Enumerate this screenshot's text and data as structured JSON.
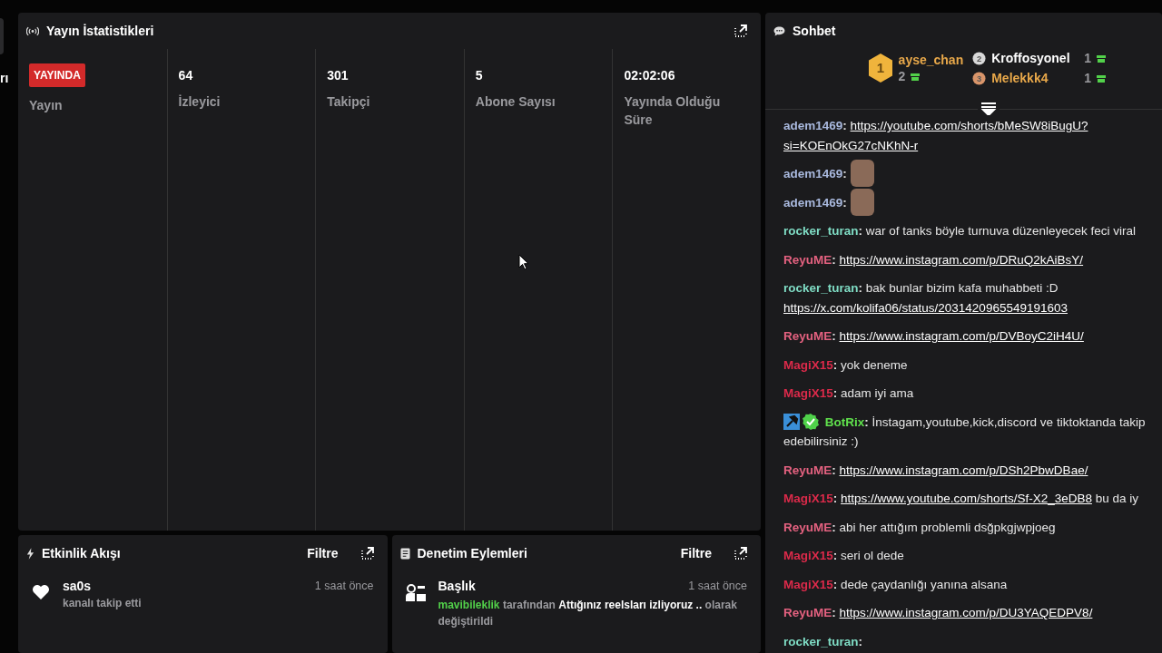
{
  "left_edge": {
    "text": "rı"
  },
  "stats": {
    "title": "Yayın İstatistikleri",
    "items": [
      {
        "kind": "status",
        "live": true,
        "badge": "YAYINDA",
        "label": "Yayın"
      },
      {
        "kind": "number",
        "value": "64",
        "label": "İzleyici"
      },
      {
        "kind": "number",
        "value": "301",
        "label": "Takipçi"
      },
      {
        "kind": "number",
        "value": "5",
        "label": "Abone Sayısı"
      },
      {
        "kind": "number",
        "value": "02:02:06",
        "label": "Yayında Olduğu Süre"
      }
    ]
  },
  "activity": {
    "title": "Etkinlik Akışı",
    "filter": "Filtre",
    "items": [
      {
        "name": "sa0s",
        "action": "kanalı takip etti",
        "time": "1 saat önce"
      }
    ]
  },
  "moderation": {
    "title": "Denetim Eylemleri",
    "filter": "Filtre",
    "items": [
      {
        "title": "Başlık",
        "time": "1 saat önce",
        "user": "mavibileklik",
        "text": "tarafından **Attığınız reelsları izliyoruz ..** olarak değiştirildi"
      }
    ]
  },
  "chat": {
    "title": "Sohbet",
    "leaders": [
      {
        "rank": "1",
        "name": "ayse_chan",
        "count": "2",
        "color": "#e8a84a"
      },
      {
        "rank": "2",
        "name": "Kroffosyonel",
        "count": "1",
        "color": "#ffffff"
      },
      {
        "rank": "3",
        "name": "Melekkk4",
        "count": "1",
        "color": "#e8a84a"
      }
    ],
    "messages": [
      {
        "user": "adem1469",
        "sep": ":",
        "color": "#a9b9de",
        "parts": [
          {
            "kind": "link",
            "text": "https://youtube.com/shorts/bMeSW8iBugU?"
          },
          {
            "kind": "break"
          },
          {
            "kind": "link",
            "text": "si=KOEnOkG27cNKhN-r"
          }
        ]
      },
      {
        "user": "adem1469",
        "sep": ":",
        "color": "#a9b9de",
        "parts": [
          {
            "kind": "emote"
          }
        ]
      },
      {
        "user": "adem1469",
        "sep": ":",
        "color": "#a9b9de",
        "parts": [
          {
            "kind": "emote"
          }
        ]
      },
      {
        "user": "rocker_turan",
        "sep": ":",
        "color": "#7fdcc4",
        "parts": [
          {
            "kind": "text",
            "text": "war of tanks böyle turnuva düzenleyecek feci viral"
          }
        ]
      },
      {
        "user": "ReyuME",
        "sep": ":",
        "color": "#e3617f",
        "parts": [
          {
            "kind": "link",
            "text": "https://www.instagram.com/p/DRuQ2kAiBsY/"
          }
        ]
      },
      {
        "user": "rocker_turan",
        "sep": ":",
        "color": "#7fdcc4",
        "parts": [
          {
            "kind": "text",
            "text": "bak bunlar bizim kafa muhabbeti :D"
          },
          {
            "kind": "break"
          },
          {
            "kind": "link",
            "text": "https://x.com/kolifa06/status/2031420965549191603"
          }
        ]
      },
      {
        "user": "ReyuME",
        "sep": ":",
        "color": "#e3617f",
        "parts": [
          {
            "kind": "link",
            "text": "https://www.instagram.com/p/DVBoyC2iH4U/"
          }
        ]
      },
      {
        "user": "MagiX15",
        "sep": ":",
        "color": "#dc2a4a",
        "parts": [
          {
            "kind": "text",
            "text": "yok deneme"
          }
        ]
      },
      {
        "user": "MagiX15",
        "sep": ":",
        "color": "#dc2a4a",
        "parts": [
          {
            "kind": "text",
            "text": "adam iyi ama"
          }
        ]
      },
      {
        "user": "BotRix",
        "sep": ":",
        "color": "#5fe04c",
        "badges": [
          {
            "kind": "moderator"
          },
          {
            "kind": "verified"
          }
        ],
        "parts": [
          {
            "kind": "text",
            "text": "İnstagam,youtube,kick,discord ve tiktoktanda takip"
          },
          {
            "kind": "break"
          },
          {
            "kind": "text",
            "text": "edebilirsiniz :)"
          }
        ]
      },
      {
        "user": "ReyuME",
        "sep": ":",
        "color": "#e3617f",
        "parts": [
          {
            "kind": "link",
            "text": "https://www.instagram.com/p/DSh2PbwDBae/"
          }
        ]
      },
      {
        "user": "MagiX15",
        "sep": ":",
        "color": "#dc2a4a",
        "parts": [
          {
            "kind": "link",
            "text": "https://www.youtube.com/shorts/Sf-X2_3eDB8"
          },
          {
            "kind": "text",
            "text": "bu da iy"
          }
        ]
      },
      {
        "user": "ReyuME",
        "sep": ":",
        "color": "#e3617f",
        "parts": [
          {
            "kind": "text",
            "text": "abi her attığım problemli dsğpkgjwpjoeg"
          }
        ]
      },
      {
        "user": "MagiX15",
        "sep": ":",
        "color": "#dc2a4a",
        "parts": [
          {
            "kind": "text",
            "text": "seri ol dede"
          }
        ]
      },
      {
        "user": "MagiX15",
        "sep": ":",
        "color": "#dc2a4a",
        "parts": [
          {
            "kind": "text",
            "text": "dede çaydanlığı yanına alsana"
          }
        ]
      },
      {
        "user": "ReyuME",
        "sep": ":",
        "color": "#e3617f",
        "parts": [
          {
            "kind": "link",
            "text": "https://www.instagram.com/p/DU3YAQEDPV8/"
          }
        ]
      },
      {
        "user": "rocker_turan",
        "sep": ":",
        "color": "#7fdcc4"
      }
    ]
  }
}
